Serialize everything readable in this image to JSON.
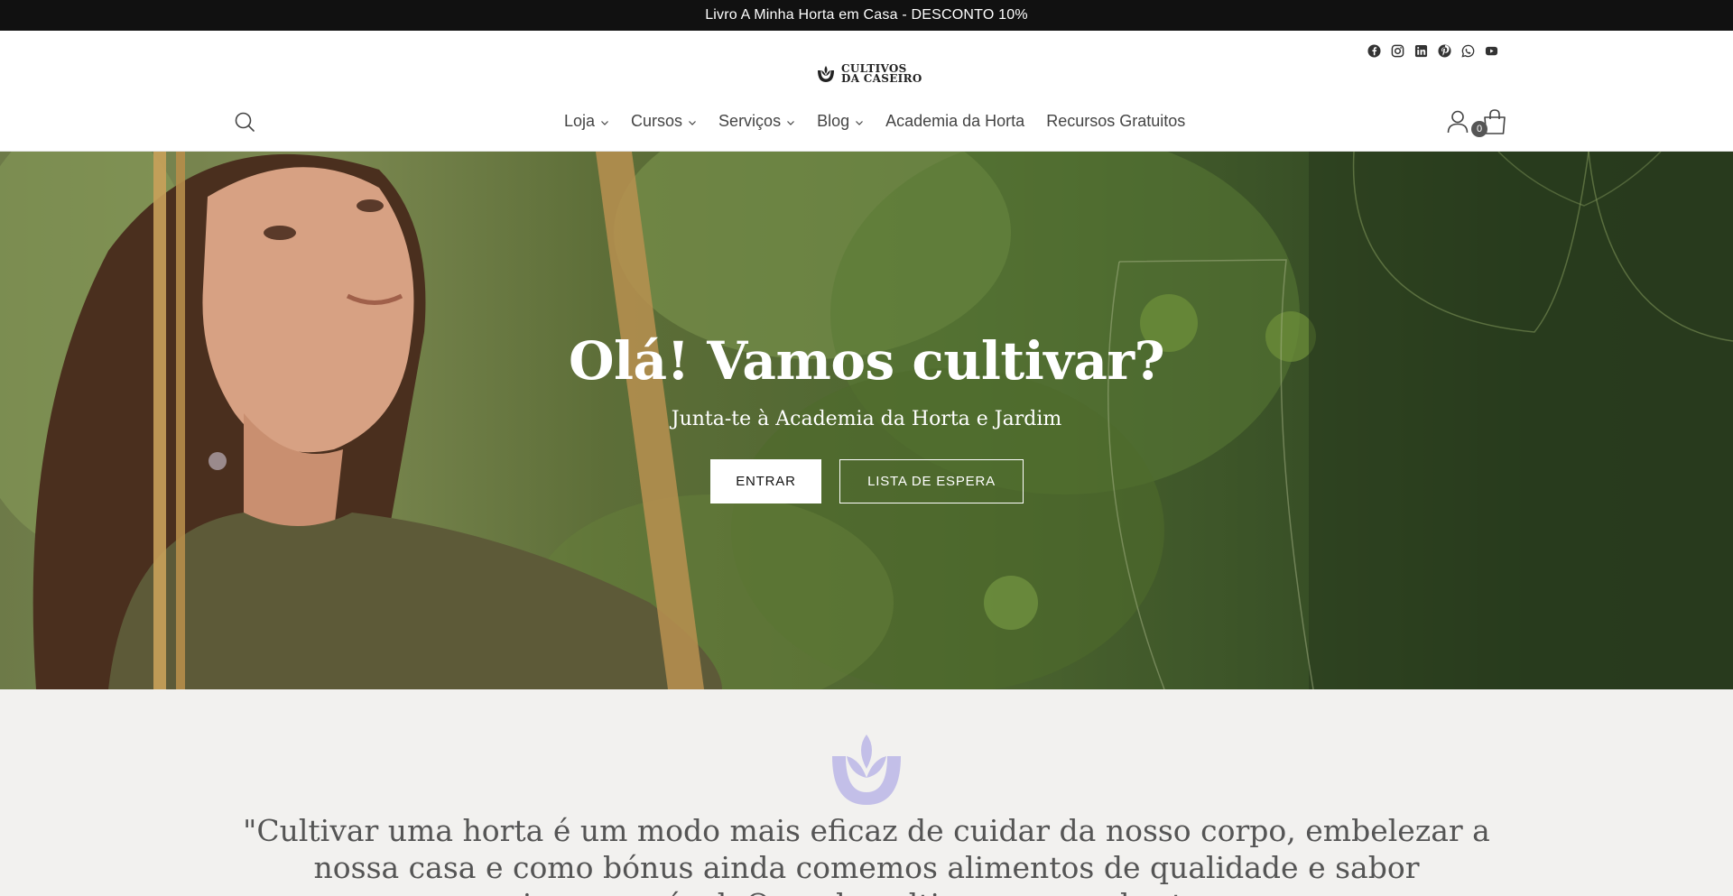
{
  "announcement": {
    "text": "Livro A Minha Horta em Casa - DESCONTO 10%"
  },
  "header": {
    "logo": {
      "line1": "CULTIVOS",
      "line2": "DA CASEIRO"
    },
    "socials": [
      "facebook-icon",
      "instagram-icon",
      "linkedin-icon",
      "pinterest-icon",
      "whatsapp-icon",
      "youtube-icon"
    ],
    "nav": [
      {
        "label": "Loja",
        "dropdown": true
      },
      {
        "label": "Cursos",
        "dropdown": true
      },
      {
        "label": "Serviços",
        "dropdown": true
      },
      {
        "label": "Blog",
        "dropdown": true
      },
      {
        "label": "Academia da Horta",
        "dropdown": false
      },
      {
        "label": "Recursos Gratuitos",
        "dropdown": false
      }
    ],
    "cart_count": "0"
  },
  "hero": {
    "title": "Olá! Vamos cultivar?",
    "subtitle": "Junta-te à Academia da Horta e Jardim",
    "enter_label": "ENTRAR",
    "waitlist_label": "LISTA DE ESPERA"
  },
  "quote": {
    "text": "\"Cultivar uma horta é um modo mais eficaz de cuidar da nosso corpo, embelezar a nossa casa e como bónus ainda comemos alimentos de qualidade e sabor incomparável. Quando cultivamos uma horta,"
  },
  "colors": {
    "announcement_bg": "#111111",
    "hero_green": "#2a3c1f",
    "accent_lavender": "#c3bfe8"
  }
}
